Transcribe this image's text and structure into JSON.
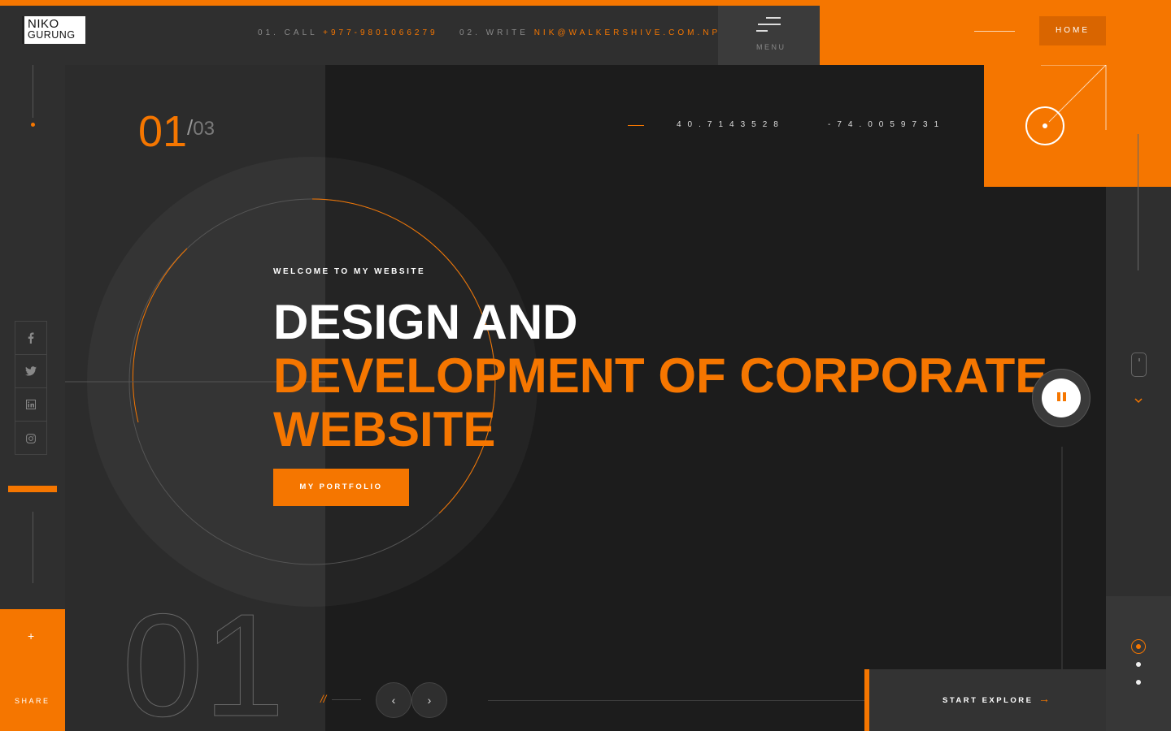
{
  "logo": {
    "line1": "NIKO",
    "line2": "GURUNG"
  },
  "header": {
    "call_label": "01. CALL",
    "call_value": "+977-9801066279",
    "write_label": "02. WRITE",
    "write_value": "NIK@WALKERSHIVE.COM.NP",
    "menu_label": "MENU",
    "home_label": "HOME"
  },
  "slide": {
    "current": "01",
    "total": "03",
    "big_number": "01",
    "coord_lat": "40.7143528",
    "coord_lng": "-74.0059731",
    "welcome": "WELCOME TO MY WEBSITE",
    "title_line1": "DESIGN AND",
    "title_line2": "DEVELOPMENT OF CORPORATE",
    "title_line3": "WEBSITE",
    "cta_label": "MY PORTFOLIO"
  },
  "social": [
    {
      "icon": "facebook-icon",
      "glyph": "f"
    },
    {
      "icon": "twitter-icon",
      "glyph": "t"
    },
    {
      "icon": "linkedin-icon",
      "glyph": "in"
    },
    {
      "icon": "instagram-icon",
      "glyph": "ig"
    }
  ],
  "share": {
    "plus": "+",
    "label": "SHARE"
  },
  "nav": {
    "slash": "//",
    "prev": "‹",
    "next": "›"
  },
  "explore": {
    "label": "START EXPLORE",
    "arrow": "→"
  },
  "colors": {
    "accent": "#f57600",
    "dark": "#1c1c1c",
    "panel": "#2c2c2c"
  }
}
